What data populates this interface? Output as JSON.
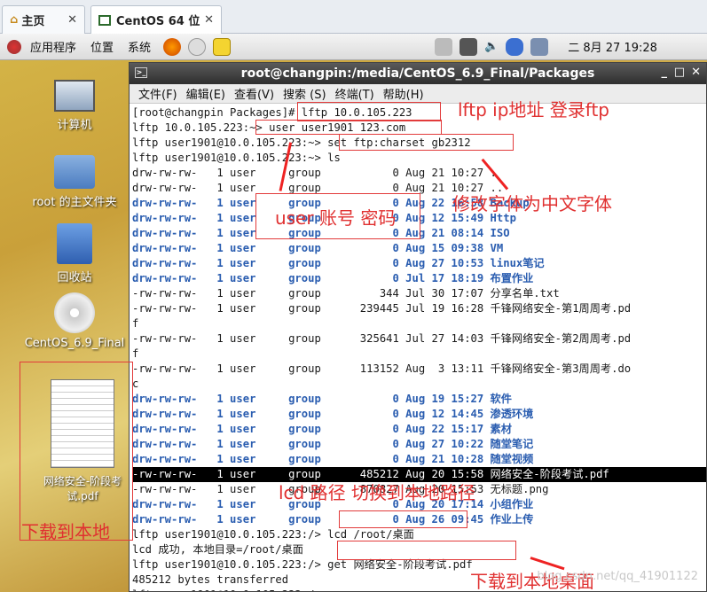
{
  "vm_tabs": [
    {
      "label": "主页"
    },
    {
      "label": "CentOS 64 位"
    }
  ],
  "panel": {
    "menu": [
      "应用程序",
      "位置",
      "系统"
    ],
    "clock": "二 8月 27 19:28"
  },
  "desktop_icons": [
    {
      "label": "计算机"
    },
    {
      "label": "root 的主文件夹"
    },
    {
      "label": "回收站"
    },
    {
      "label": "CentOS_6.9_Final"
    },
    {
      "label": "网络安全-阶段考试.pdf"
    }
  ],
  "terminal": {
    "title": "root@changpin:/media/CentOS_6.9_Final/Packages",
    "menu": [
      "文件(F)",
      "编辑(E)",
      "查看(V)",
      "搜索 (S)",
      "终端(T)",
      "帮助(H)"
    ],
    "lines": [
      "[root@changpin Packages]# lftp 10.0.105.223",
      "lftp 10.0.105.223:~> user user1901 123.com",
      "lftp user1901@10.0.105.223:~> set ftp:charset gb2312",
      "lftp user1901@10.0.105.223:~> ls",
      "drw-rw-rw-   1 user     group           0 Aug 21 10:27 .",
      "drw-rw-rw-   1 user     group           0 Aug 21 10:27 ..",
      "drw-rw-rw-   1 user     group           0 Aug 22 16:58 Backup",
      "drw-rw-rw-   1 user     group           0 Aug 12 15:49 Http",
      "drw-rw-rw-   1 user     group           0 Aug 21 08:14 ISO",
      "drw-rw-rw-   1 user     group           0 Aug 15 09:38 VM",
      "drw-rw-rw-   1 user     group           0 Aug 27 10:53 linux笔记",
      "drw-rw-rw-   1 user     group           0 Jul 17 18:19 布置作业",
      "-rw-rw-rw-   1 user     group         344 Jul 30 17:07 分享名单.txt",
      "-rw-rw-rw-   1 user     group      239445 Jul 19 16:28 千锋网络安全-第1周周考.pd",
      "f",
      "-rw-rw-rw-   1 user     group      325641 Jul 27 14:03 千锋网络安全-第2周周考.pd",
      "f",
      "-rw-rw-rw-   1 user     group      113152 Aug  3 13:11 千锋网络安全-第3周周考.do",
      "c",
      "drw-rw-rw-   1 user     group           0 Aug 19 15:27 软件",
      "drw-rw-rw-   1 user     group           0 Aug 12 14:45 渗透环境",
      "drw-rw-rw-   1 user     group           0 Aug 22 15:17 素材",
      "drw-rw-rw-   1 user     group           0 Aug 27 10:22 随堂笔记",
      "drw-rw-rw-   1 user     group           0 Aug 21 10:28 随堂视频",
      "-rw-rw-rw-   1 user     group      485212 Aug 20 15:58 网络安全-阶段考试.pdf",
      "-rw-rw-rw-   1 user     group      870827 Aug 20 15:53 无标题.png",
      "drw-rw-rw-   1 user     group           0 Aug 20 17:14 小组作业",
      "drw-rw-rw-   1 user     group           0 Aug 26 09:45 作业上传",
      "lftp user1901@10.0.105.223:/> lcd /root/桌面",
      "lcd 成功, 本地目录=/root/桌面",
      "lftp user1901@10.0.105.223:/> get 网络安全-阶段考试.pdf",
      "485212 bytes transferred",
      "lftp user1901@10.0.105.223:/>"
    ]
  },
  "annotations": {
    "lftp_ip": "lftp ip地址  登录ftp",
    "charset": "修改字体为中文字体",
    "user": "user 账号 密码",
    "lcd": "lcd 路径  切换到本地路径",
    "download_local": "下载到本地",
    "download_desktop": "下载到本地桌面"
  },
  "watermark": "blog.csdn.net/qq_41901122",
  "colors": {
    "annotation": "#e03030",
    "dir_blue": "#2a5db0"
  }
}
